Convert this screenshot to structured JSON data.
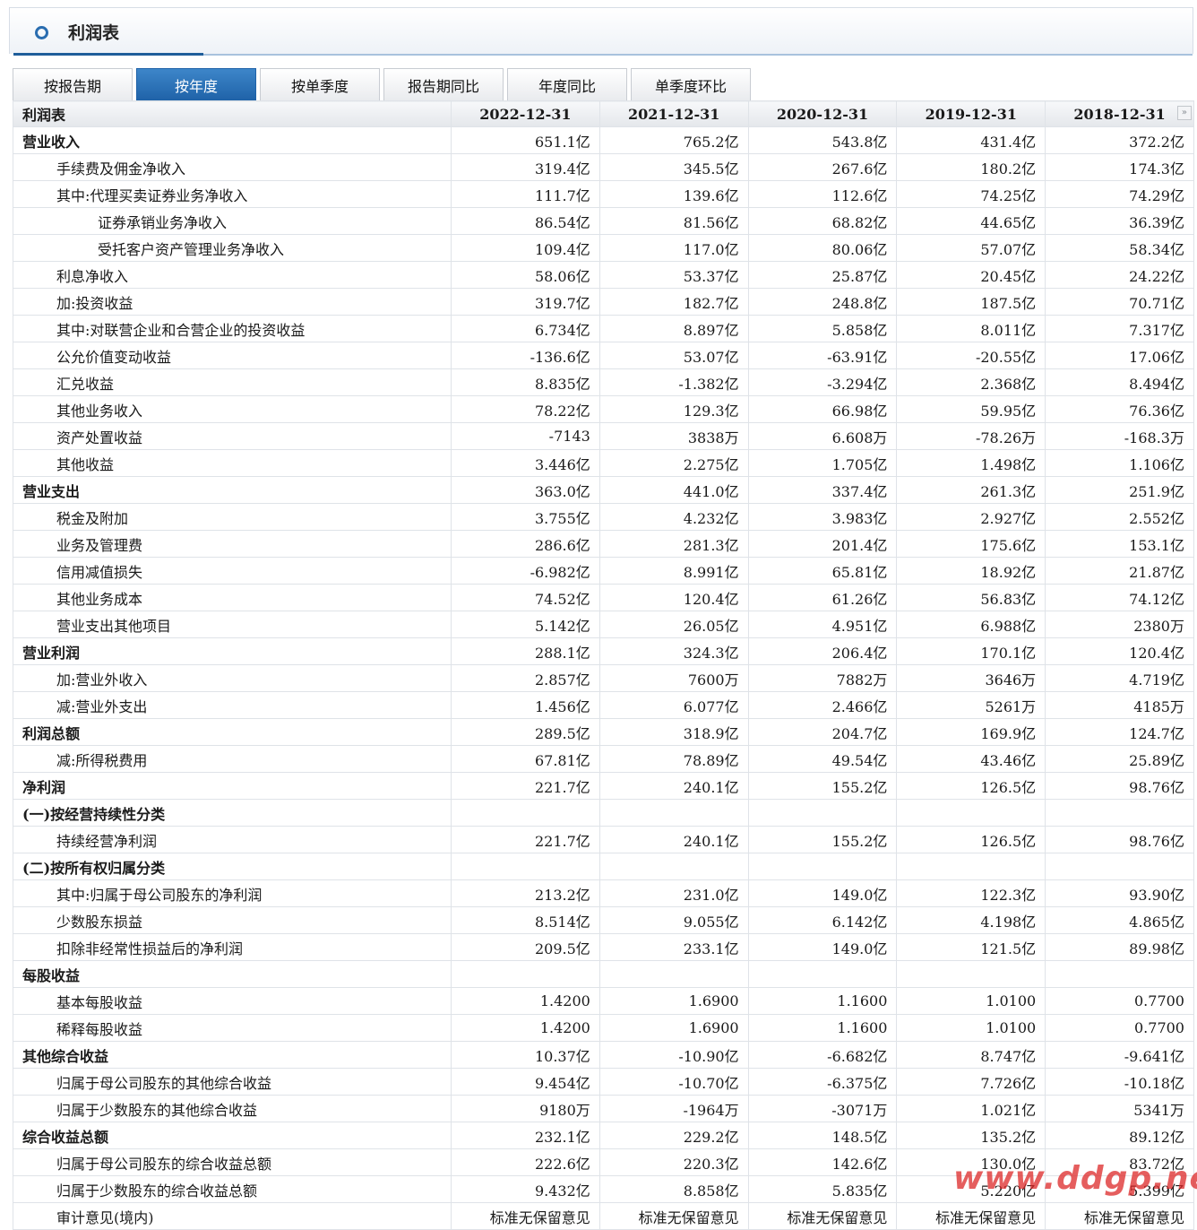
{
  "header": {
    "title": "利润表"
  },
  "tabs": [
    {
      "label": "按报告期",
      "active": false
    },
    {
      "label": "按年度",
      "active": true
    },
    {
      "label": "按单季度",
      "active": false
    },
    {
      "label": "报告期同比",
      "active": false
    },
    {
      "label": "年度同比",
      "active": false
    },
    {
      "label": "单季度环比",
      "active": false
    }
  ],
  "table": {
    "label_header": "利润表",
    "columns": [
      "2022-12-31",
      "2021-12-31",
      "2020-12-31",
      "2019-12-31",
      "2018-12-31"
    ],
    "scroll_icon": "»",
    "rows": [
      {
        "label": "营业收入",
        "level": 0,
        "values": [
          "651.1亿",
          "765.2亿",
          "543.8亿",
          "431.4亿",
          "372.2亿"
        ]
      },
      {
        "label": "手续费及佣金净收入",
        "level": 1,
        "values": [
          "319.4亿",
          "345.5亿",
          "267.6亿",
          "180.2亿",
          "174.3亿"
        ]
      },
      {
        "label": "其中:代理买卖证券业务净收入",
        "level": 1,
        "values": [
          "111.7亿",
          "139.6亿",
          "112.6亿",
          "74.25亿",
          "74.29亿"
        ]
      },
      {
        "label": "证券承销业务净收入",
        "level": 2,
        "values": [
          "86.54亿",
          "81.56亿",
          "68.82亿",
          "44.65亿",
          "36.39亿"
        ]
      },
      {
        "label": "受托客户资产管理业务净收入",
        "level": 2,
        "values": [
          "109.4亿",
          "117.0亿",
          "80.06亿",
          "57.07亿",
          "58.34亿"
        ]
      },
      {
        "label": "利息净收入",
        "level": 1,
        "values": [
          "58.06亿",
          "53.37亿",
          "25.87亿",
          "20.45亿",
          "24.22亿"
        ]
      },
      {
        "label": "加:投资收益",
        "level": 1,
        "values": [
          "319.7亿",
          "182.7亿",
          "248.8亿",
          "187.5亿",
          "70.71亿"
        ]
      },
      {
        "label": "其中:对联营企业和合营企业的投资收益",
        "level": 1,
        "values": [
          "6.734亿",
          "8.897亿",
          "5.858亿",
          "8.011亿",
          "7.317亿"
        ]
      },
      {
        "label": "公允价值变动收益",
        "level": 1,
        "values": [
          "-136.6亿",
          "53.07亿",
          "-63.91亿",
          "-20.55亿",
          "17.06亿"
        ]
      },
      {
        "label": "汇兑收益",
        "level": 1,
        "values": [
          "8.835亿",
          "-1.382亿",
          "-3.294亿",
          "2.368亿",
          "8.494亿"
        ]
      },
      {
        "label": "其他业务收入",
        "level": 1,
        "values": [
          "78.22亿",
          "129.3亿",
          "66.98亿",
          "59.95亿",
          "76.36亿"
        ]
      },
      {
        "label": "资产处置收益",
        "level": 1,
        "values": [
          "-7143",
          "3838万",
          "6.608万",
          "-78.26万",
          "-168.3万"
        ]
      },
      {
        "label": "其他收益",
        "level": 1,
        "values": [
          "3.446亿",
          "2.275亿",
          "1.705亿",
          "1.498亿",
          "1.106亿"
        ]
      },
      {
        "label": "营业支出",
        "level": 0,
        "values": [
          "363.0亿",
          "441.0亿",
          "337.4亿",
          "261.3亿",
          "251.9亿"
        ]
      },
      {
        "label": "税金及附加",
        "level": 1,
        "values": [
          "3.755亿",
          "4.232亿",
          "3.983亿",
          "2.927亿",
          "2.552亿"
        ]
      },
      {
        "label": "业务及管理费",
        "level": 1,
        "values": [
          "286.6亿",
          "281.3亿",
          "201.4亿",
          "175.6亿",
          "153.1亿"
        ]
      },
      {
        "label": "信用减值损失",
        "level": 1,
        "values": [
          "-6.982亿",
          "8.991亿",
          "65.81亿",
          "18.92亿",
          "21.87亿"
        ]
      },
      {
        "label": "其他业务成本",
        "level": 1,
        "values": [
          "74.52亿",
          "120.4亿",
          "61.26亿",
          "56.83亿",
          "74.12亿"
        ]
      },
      {
        "label": "营业支出其他项目",
        "level": 1,
        "values": [
          "5.142亿",
          "26.05亿",
          "4.951亿",
          "6.988亿",
          "2380万"
        ]
      },
      {
        "label": "营业利润",
        "level": 0,
        "values": [
          "288.1亿",
          "324.3亿",
          "206.4亿",
          "170.1亿",
          "120.4亿"
        ]
      },
      {
        "label": "加:营业外收入",
        "level": 1,
        "values": [
          "2.857亿",
          "7600万",
          "7882万",
          "3646万",
          "4.719亿"
        ]
      },
      {
        "label": "减:营业外支出",
        "level": 1,
        "values": [
          "1.456亿",
          "6.077亿",
          "2.466亿",
          "5261万",
          "4185万"
        ]
      },
      {
        "label": "利润总额",
        "level": 0,
        "values": [
          "289.5亿",
          "318.9亿",
          "204.7亿",
          "169.9亿",
          "124.7亿"
        ]
      },
      {
        "label": "减:所得税费用",
        "level": 1,
        "values": [
          "67.81亿",
          "78.89亿",
          "49.54亿",
          "43.46亿",
          "25.89亿"
        ]
      },
      {
        "label": "净利润",
        "level": 0,
        "values": [
          "221.7亿",
          "240.1亿",
          "155.2亿",
          "126.5亿",
          "98.76亿"
        ]
      },
      {
        "label": "(一)按经营持续性分类",
        "level": 0,
        "values": [
          "",
          "",
          "",
          "",
          ""
        ]
      },
      {
        "label": "持续经营净利润",
        "level": 1,
        "values": [
          "221.7亿",
          "240.1亿",
          "155.2亿",
          "126.5亿",
          "98.76亿"
        ]
      },
      {
        "label": "(二)按所有权归属分类",
        "level": 0,
        "values": [
          "",
          "",
          "",
          "",
          ""
        ]
      },
      {
        "label": "其中:归属于母公司股东的净利润",
        "level": 1,
        "values": [
          "213.2亿",
          "231.0亿",
          "149.0亿",
          "122.3亿",
          "93.90亿"
        ]
      },
      {
        "label": "少数股东损益",
        "level": 1,
        "values": [
          "8.514亿",
          "9.055亿",
          "6.142亿",
          "4.198亿",
          "4.865亿"
        ]
      },
      {
        "label": "扣除非经常性损益后的净利润",
        "level": 1,
        "values": [
          "209.5亿",
          "233.1亿",
          "149.0亿",
          "121.5亿",
          "89.98亿"
        ]
      },
      {
        "label": "每股收益",
        "level": 0,
        "values": [
          "",
          "",
          "",
          "",
          ""
        ]
      },
      {
        "label": "基本每股收益",
        "level": 1,
        "values": [
          "1.4200",
          "1.6900",
          "1.1600",
          "1.0100",
          "0.7700"
        ]
      },
      {
        "label": "稀释每股收益",
        "level": 1,
        "values": [
          "1.4200",
          "1.6900",
          "1.1600",
          "1.0100",
          "0.7700"
        ]
      },
      {
        "label": "其他综合收益",
        "level": 0,
        "values": [
          "10.37亿",
          "-10.90亿",
          "-6.682亿",
          "8.747亿",
          "-9.641亿"
        ]
      },
      {
        "label": "归属于母公司股东的其他综合收益",
        "level": 1,
        "values": [
          "9.454亿",
          "-10.70亿",
          "-6.375亿",
          "7.726亿",
          "-10.18亿"
        ]
      },
      {
        "label": "归属于少数股东的其他综合收益",
        "level": 1,
        "values": [
          "9180万",
          "-1964万",
          "-3071万",
          "1.021亿",
          "5341万"
        ]
      },
      {
        "label": "综合收益总额",
        "level": 0,
        "values": [
          "232.1亿",
          "229.2亿",
          "148.5亿",
          "135.2亿",
          "89.12亿"
        ]
      },
      {
        "label": "归属于母公司股东的综合收益总额",
        "level": 1,
        "values": [
          "222.6亿",
          "220.3亿",
          "142.6亿",
          "130.0亿",
          "83.72亿"
        ]
      },
      {
        "label": "归属于少数股东的综合收益总额",
        "level": 1,
        "values": [
          "9.432亿",
          "8.858亿",
          "5.835亿",
          "5.220亿",
          "5.399亿"
        ]
      },
      {
        "label": "审计意见(境内)",
        "level": 1,
        "values": [
          "标准无保留意见",
          "标准无保留意见",
          "标准无保留意见",
          "标准无保留意见",
          "标准无保留意见"
        ]
      }
    ]
  },
  "watermark": {
    "text": "www.ddgp.net"
  }
}
